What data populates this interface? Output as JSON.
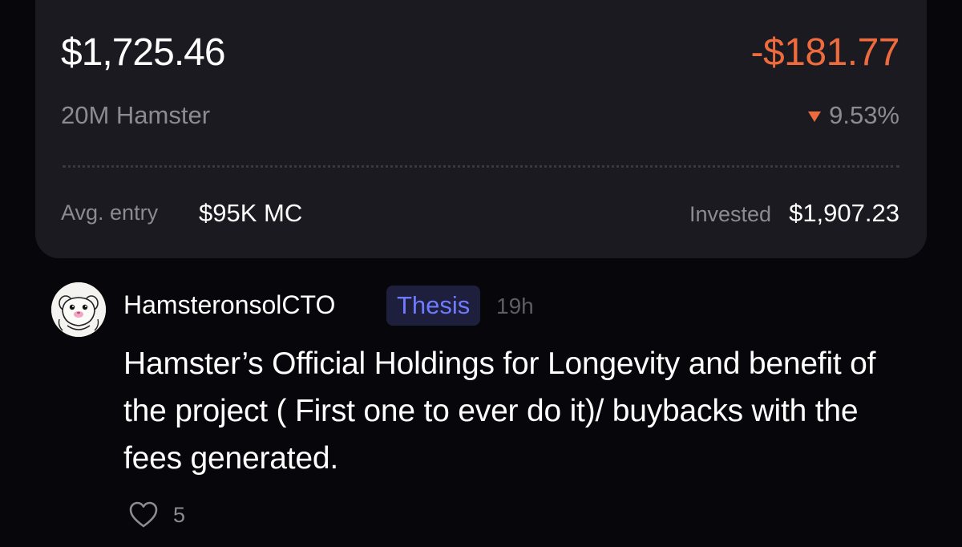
{
  "position": {
    "value": "$1,725.46",
    "pnl_abs": "-$181.77",
    "token_amount": "20M Hamster",
    "pnl_pct": "9.53%",
    "avg_entry_label": "Avg. entry",
    "avg_entry_value": "$95K MC",
    "invested_label": "Invested",
    "invested_value": "$1,907.23",
    "colors": {
      "negative": "#ee6b3d",
      "card_bg": "#1b1a20",
      "muted": "#8c8b93"
    },
    "trend_icon": "triangle-down-icon"
  },
  "post": {
    "author": "HamsteronsolCTO",
    "tag": "Thesis",
    "time": "19h",
    "body": "Hamster’s Official Holdings for Longevity and benefit of the project ( First one to ever do it)/ buybacks with the fees generated.",
    "likes": "5",
    "avatar_icon": "hamster-avatar-icon",
    "like_icon": "heart-outline-icon",
    "colors": {
      "tag_text": "#6f7bff",
      "tag_bg": "#1e1f3d"
    }
  }
}
